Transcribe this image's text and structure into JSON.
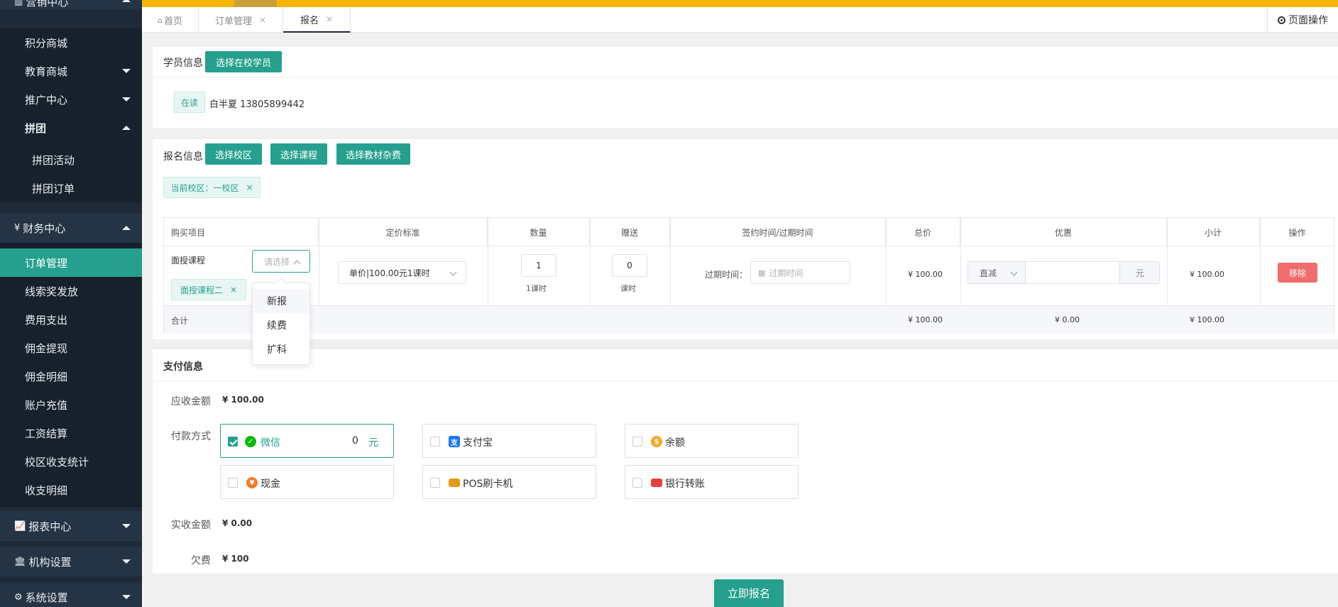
{
  "sidebar": {
    "top_partial": "营销中心",
    "items": [
      {
        "label": "积分商城"
      },
      {
        "label": "教育商城"
      },
      {
        "label": "推广中心"
      },
      {
        "label": "拼团"
      },
      {
        "label": "拼团活动"
      },
      {
        "label": "拼团订单"
      },
      {
        "label": "财务中心"
      },
      {
        "label": "订单管理"
      },
      {
        "label": "线索奖发放"
      },
      {
        "label": "费用支出"
      },
      {
        "label": "佣金提现"
      },
      {
        "label": "佣金明细"
      },
      {
        "label": "账户充值"
      },
      {
        "label": "工资结算"
      },
      {
        "label": "校区收支统计"
      },
      {
        "label": "收支明细"
      },
      {
        "label": "报表中心"
      },
      {
        "label": "机构设置"
      },
      {
        "label": "系统设置"
      }
    ]
  },
  "tabs": [
    {
      "label": "首页"
    },
    {
      "label": "订单管理",
      "close": "×"
    },
    {
      "label": "报名",
      "close": "×"
    }
  ],
  "page_ops_label": "页面操作",
  "student": {
    "title": "学员信息",
    "select_button": "选择在校学员",
    "status_tag": "在读",
    "name_phone": "白半夏 13805899442"
  },
  "enroll": {
    "title": "报名信息",
    "buttons": [
      "选择校区",
      "选择课程",
      "选择教材杂费"
    ],
    "campus_tag": "当前校区：一校区",
    "campus_tag_close": "×",
    "columns": [
      "购买项目",
      "定价标准",
      "数量",
      "赠送",
      "签约时间/过期时间",
      "总价",
      "优惠",
      "小计",
      "操作"
    ],
    "row": {
      "item_type": "面授课程",
      "type_select_placeholder": "请选择",
      "course_tag": "面授课程二",
      "course_tag_close": "×",
      "pricing": "单价|100.00元1课时",
      "quantity": "1",
      "quantity_unit": "1课时",
      "gift": "0",
      "gift_unit": "课时",
      "expire_label": "过期时间：",
      "expire_placeholder": "过期时间",
      "total": "¥ 100.00",
      "discount_type": "直减",
      "discount_unit": "元",
      "subtotal": "¥ 100.00",
      "remove": "移除"
    },
    "total_row": {
      "label": "合计",
      "total": "¥ 100.00",
      "discount": "¥ 0.00",
      "subtotal": "¥ 100.00"
    },
    "dropdown_options": [
      "新报",
      "续费",
      "扩科"
    ]
  },
  "payment": {
    "title": "支付信息",
    "receivable_label": "应收金额",
    "receivable_value": "¥ 100.00",
    "method_label": "付款方式",
    "methods": [
      {
        "name": "微信",
        "checked": true,
        "amount": "0",
        "unit": "元",
        "icon": "wechat-icon",
        "color": "#09bb07"
      },
      {
        "name": "支付宝",
        "checked": false,
        "icon": "alipay-icon",
        "color": "#1677ff"
      },
      {
        "name": "余额",
        "checked": false,
        "icon": "balance-bag-icon",
        "color": "#f5a623"
      },
      {
        "name": "现金",
        "checked": false,
        "icon": "cash-icon",
        "color": "#f07a2a"
      },
      {
        "name": "POS刷卡机",
        "checked": false,
        "icon": "pos-card-icon",
        "color": "#e29a1a"
      },
      {
        "name": "银行转账",
        "checked": false,
        "icon": "bank-card-icon",
        "color": "#e8413c"
      }
    ],
    "actual_label": "实收金额",
    "actual_value": "¥ 0.00",
    "owed_label": "欠费",
    "owed_value": "¥ 100"
  },
  "submit_label": "立即报名",
  "colors": {
    "accent": "#26a08e",
    "sidebar": "#1e2a38",
    "topbar": "#f7b500",
    "danger": "#f16c6c"
  }
}
